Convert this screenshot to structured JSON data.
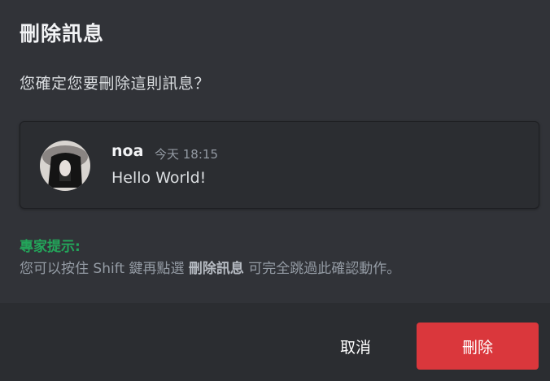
{
  "dialog": {
    "title": "刪除訊息",
    "question": "您確定您要刪除這則訊息？"
  },
  "message": {
    "username": "noa",
    "timestamp": "今天 18:15",
    "content": "Hello World!"
  },
  "tip": {
    "title": "專家提示:",
    "text_before": "您可以按住 Shift 鍵再點選 ",
    "bold_text": "刪除訊息",
    "text_after": " 可完全跳過此確認動作。"
  },
  "buttons": {
    "cancel_label": "取消",
    "delete_label": "刪除"
  },
  "colors": {
    "background": "#313338",
    "footer": "#2b2d31",
    "delete_button": "#da373c",
    "tip_title": "#23a55a"
  }
}
